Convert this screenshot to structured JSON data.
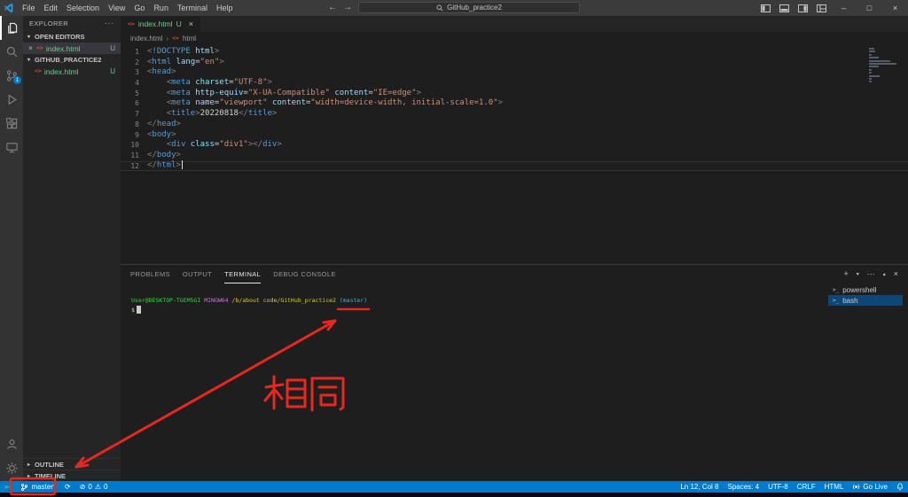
{
  "titlebar": {
    "menus": [
      "File",
      "Edit",
      "Selection",
      "View",
      "Go",
      "Run",
      "Terminal",
      "Help"
    ],
    "search_label": "GitHub_practice2"
  },
  "activity_bar": {
    "scm_badge": "1"
  },
  "sidebar": {
    "header": "EXPLORER",
    "sections": {
      "open_editors": "OPEN EDITORS",
      "folder": "GITHUB_PRACTICE2",
      "outline": "OUTLINE",
      "timeline": "TIMELINE"
    },
    "open_editor_items": [
      {
        "file": "index.html",
        "badge": "U"
      }
    ],
    "folder_items": [
      {
        "file": "index.html",
        "badge": "U"
      }
    ]
  },
  "editor": {
    "tab": {
      "file": "index.html",
      "badge": "U"
    },
    "breadcrumbs": [
      "index.html",
      "html"
    ],
    "code_lines": [
      {
        "n": 1,
        "toks": [
          [
            "p",
            "<"
          ],
          [
            "t",
            "!DOCTYPE"
          ],
          [
            "x",
            " "
          ],
          [
            "a",
            "html"
          ],
          [
            "p",
            ">"
          ]
        ]
      },
      {
        "n": 2,
        "toks": [
          [
            "p",
            "<"
          ],
          [
            "t",
            "html"
          ],
          [
            "x",
            " "
          ],
          [
            "a",
            "lang"
          ],
          [
            "e",
            "="
          ],
          [
            "s",
            "\"en\""
          ],
          [
            "p",
            ">"
          ]
        ]
      },
      {
        "n": 3,
        "toks": [
          [
            "p",
            "<"
          ],
          [
            "t",
            "head"
          ],
          [
            "p",
            ">"
          ]
        ]
      },
      {
        "n": 4,
        "toks": [
          [
            "x",
            "    "
          ],
          [
            "p",
            "<"
          ],
          [
            "t",
            "meta"
          ],
          [
            "x",
            " "
          ],
          [
            "a",
            "charset"
          ],
          [
            "e",
            "="
          ],
          [
            "s",
            "\"UTF-8\""
          ],
          [
            "p",
            ">"
          ]
        ]
      },
      {
        "n": 5,
        "toks": [
          [
            "x",
            "    "
          ],
          [
            "p",
            "<"
          ],
          [
            "t",
            "meta"
          ],
          [
            "x",
            " "
          ],
          [
            "a",
            "http-equiv"
          ],
          [
            "e",
            "="
          ],
          [
            "s",
            "\"X-UA-Compatible\""
          ],
          [
            "x",
            " "
          ],
          [
            "a",
            "content"
          ],
          [
            "e",
            "="
          ],
          [
            "s",
            "\"IE=edge\""
          ],
          [
            "p",
            ">"
          ]
        ]
      },
      {
        "n": 6,
        "toks": [
          [
            "x",
            "    "
          ],
          [
            "p",
            "<"
          ],
          [
            "t",
            "meta"
          ],
          [
            "x",
            " "
          ],
          [
            "a",
            "name"
          ],
          [
            "e",
            "="
          ],
          [
            "s",
            "\"viewport\""
          ],
          [
            "x",
            " "
          ],
          [
            "a",
            "content"
          ],
          [
            "e",
            "="
          ],
          [
            "s",
            "\"width=device-width, initial-scale=1.0\""
          ],
          [
            "p",
            ">"
          ]
        ]
      },
      {
        "n": 7,
        "toks": [
          [
            "x",
            "    "
          ],
          [
            "p",
            "<"
          ],
          [
            "t",
            "title"
          ],
          [
            "p",
            ">"
          ],
          [
            "x",
            "20220818"
          ],
          [
            "p",
            "</"
          ],
          [
            "t",
            "title"
          ],
          [
            "p",
            ">"
          ]
        ]
      },
      {
        "n": 8,
        "toks": [
          [
            "p",
            "</"
          ],
          [
            "t",
            "head"
          ],
          [
            "p",
            ">"
          ]
        ]
      },
      {
        "n": 9,
        "toks": [
          [
            "p",
            "<"
          ],
          [
            "t",
            "body"
          ],
          [
            "p",
            ">"
          ]
        ]
      },
      {
        "n": 10,
        "toks": [
          [
            "x",
            "    "
          ],
          [
            "p",
            "<"
          ],
          [
            "t",
            "div"
          ],
          [
            "x",
            " "
          ],
          [
            "a",
            "class"
          ],
          [
            "e",
            "="
          ],
          [
            "s",
            "\"div1\""
          ],
          [
            "p",
            "></"
          ],
          [
            "t",
            "div"
          ],
          [
            "p",
            ">"
          ]
        ]
      },
      {
        "n": 11,
        "toks": [
          [
            "p",
            "</"
          ],
          [
            "t",
            "body"
          ],
          [
            "p",
            ">"
          ]
        ]
      },
      {
        "n": 12,
        "toks": [
          [
            "p",
            "</"
          ],
          [
            "t",
            "html"
          ],
          [
            "p",
            ">"
          ]
        ],
        "current": true,
        "cursor": true
      }
    ]
  },
  "panel": {
    "tabs": [
      "PROBLEMS",
      "OUTPUT",
      "TERMINAL",
      "DEBUG CONSOLE"
    ],
    "active_tab": 2,
    "terminal": {
      "prompt": [
        [
          "green",
          "User@DESKTOP-TGEM5GI"
        ],
        [
          "plain",
          " "
        ],
        [
          "purple",
          "MINGW64"
        ],
        [
          "plain",
          " "
        ],
        [
          "yellow",
          "/b/about code/GitHub_practice2"
        ],
        [
          "plain",
          " "
        ],
        [
          "cyan",
          "(master)"
        ]
      ],
      "prompt2": "$"
    },
    "shell_list": [
      {
        "label": "powershell",
        "active": false
      },
      {
        "label": "bash",
        "active": true
      }
    ]
  },
  "status_bar": {
    "branch": "master*",
    "errors": "0",
    "warnings": "0",
    "line_col": "Ln 12, Col 8",
    "spaces": "Spaces: 4",
    "encoding": "UTF-8",
    "eol": "CRLF",
    "language": "HTML",
    "go_live": "Go Live"
  },
  "annotation": {
    "label": "相同"
  },
  "icons": {
    "vscode-logo": "blue-ribbon",
    "back-icon": "←",
    "forward-icon": "→",
    "search-icon": "magnifier",
    "minimize-icon": "–",
    "maximize-icon": "□",
    "close-icon": "×",
    "explorer-icon": "files",
    "source-control-icon": "git-branch",
    "run-debug-icon": "play",
    "extensions-icon": "squares",
    "remote-explorer-icon": "monitor",
    "account-icon": "person",
    "settings-icon": "gear",
    "html-file-icon": "<>",
    "branch-icon": "git-branch",
    "sync-icon": "⟳",
    "error-icon": "⊘",
    "warning-icon": "⚠",
    "go-live-icon": "broadcast",
    "bell-icon": "bell",
    "terminal-icon": ">_"
  },
  "colors": {
    "status_bar": "#007acc",
    "annotation_red": "#e8281e",
    "untracked_green": "#73c991",
    "activity_badge": "#007acc"
  }
}
